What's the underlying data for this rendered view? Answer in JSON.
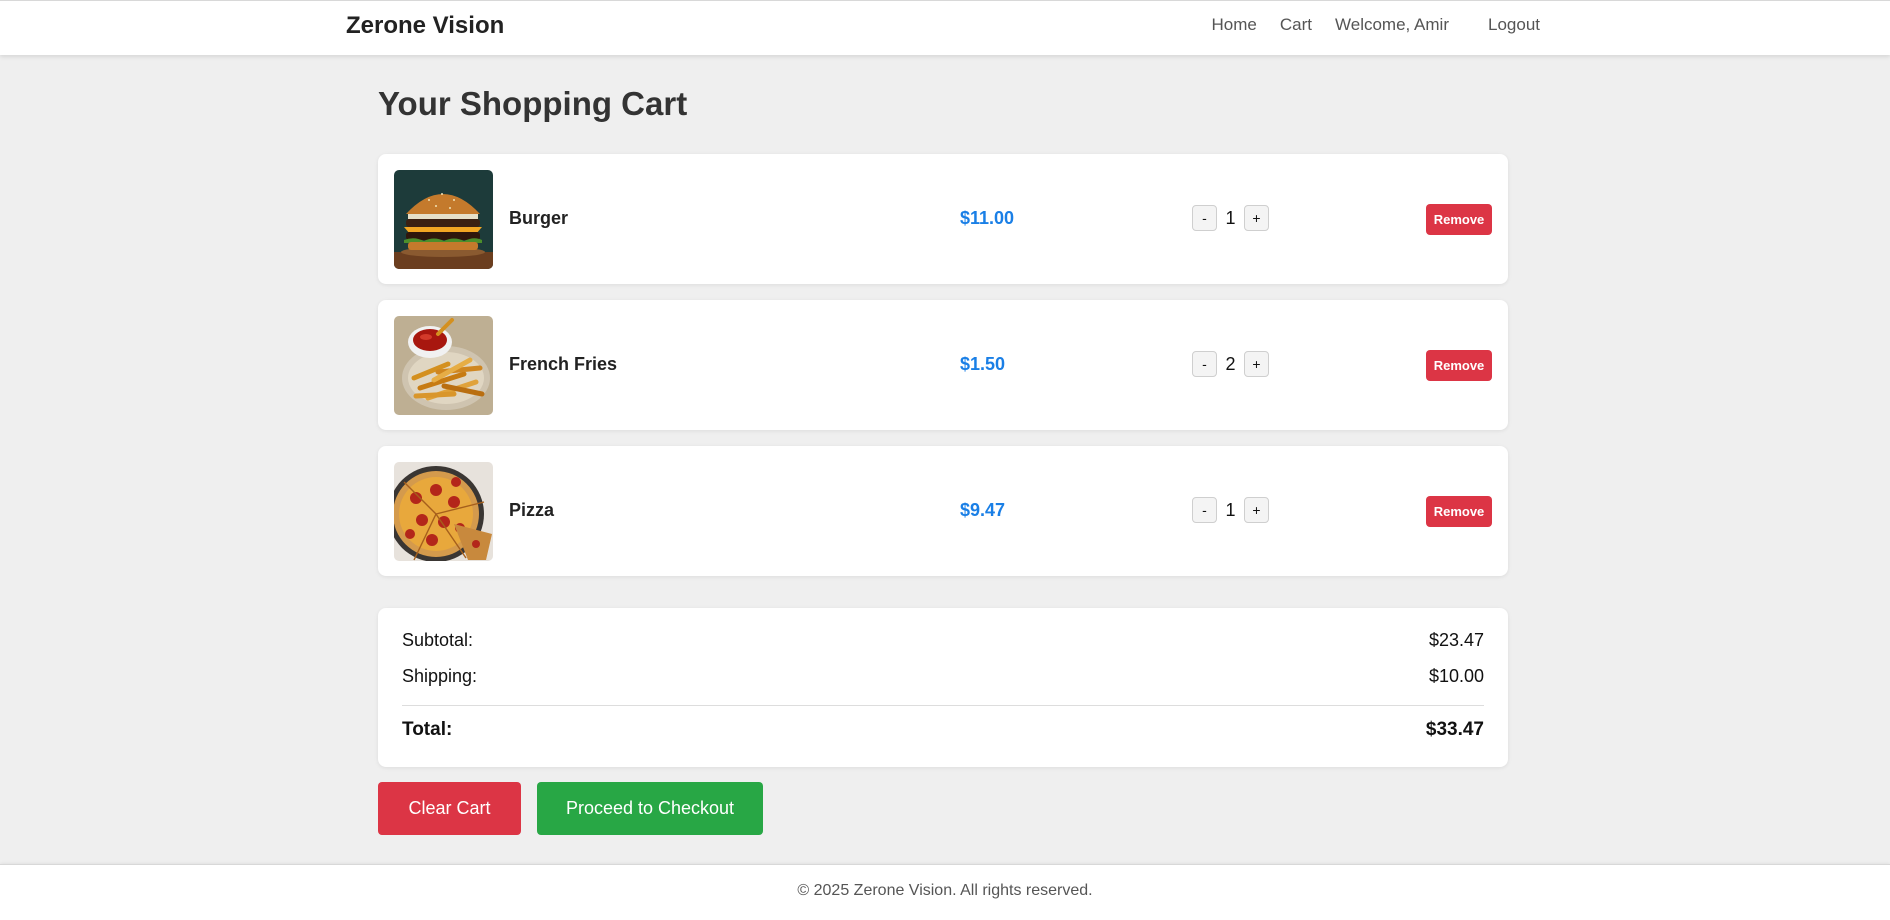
{
  "navbar": {
    "brand": "Zerone Vision",
    "links": {
      "home": "Home",
      "cart": "Cart",
      "welcome": "Welcome, Amir",
      "logout": "Logout"
    }
  },
  "page": {
    "title": "Your Shopping Cart"
  },
  "cart": {
    "items": [
      {
        "name": "Burger",
        "price": "$11.00",
        "qty": "1",
        "image": "burger-photo",
        "remove": "Remove",
        "minus": "-",
        "plus": "+"
      },
      {
        "name": "French Fries",
        "price": "$1.50",
        "qty": "2",
        "image": "fries-photo",
        "remove": "Remove",
        "minus": "-",
        "plus": "+"
      },
      {
        "name": "Pizza",
        "price": "$9.47",
        "qty": "1",
        "image": "pizza-photo",
        "remove": "Remove",
        "minus": "-",
        "plus": "+"
      }
    ]
  },
  "summary": {
    "subtotal_label": "Subtotal:",
    "subtotal_value": "$23.47",
    "shipping_label": "Shipping:",
    "shipping_value": "$10.00",
    "total_label": "Total:",
    "total_value": "$33.47"
  },
  "actions": {
    "clear": "Clear Cart",
    "checkout": "Proceed to Checkout"
  },
  "footer": {
    "text": "© 2025 Zerone Vision. All rights reserved."
  },
  "colors": {
    "accent_price": "#1a7fe6",
    "danger": "#dc3545",
    "success": "#28a745",
    "background": "#efefef"
  }
}
